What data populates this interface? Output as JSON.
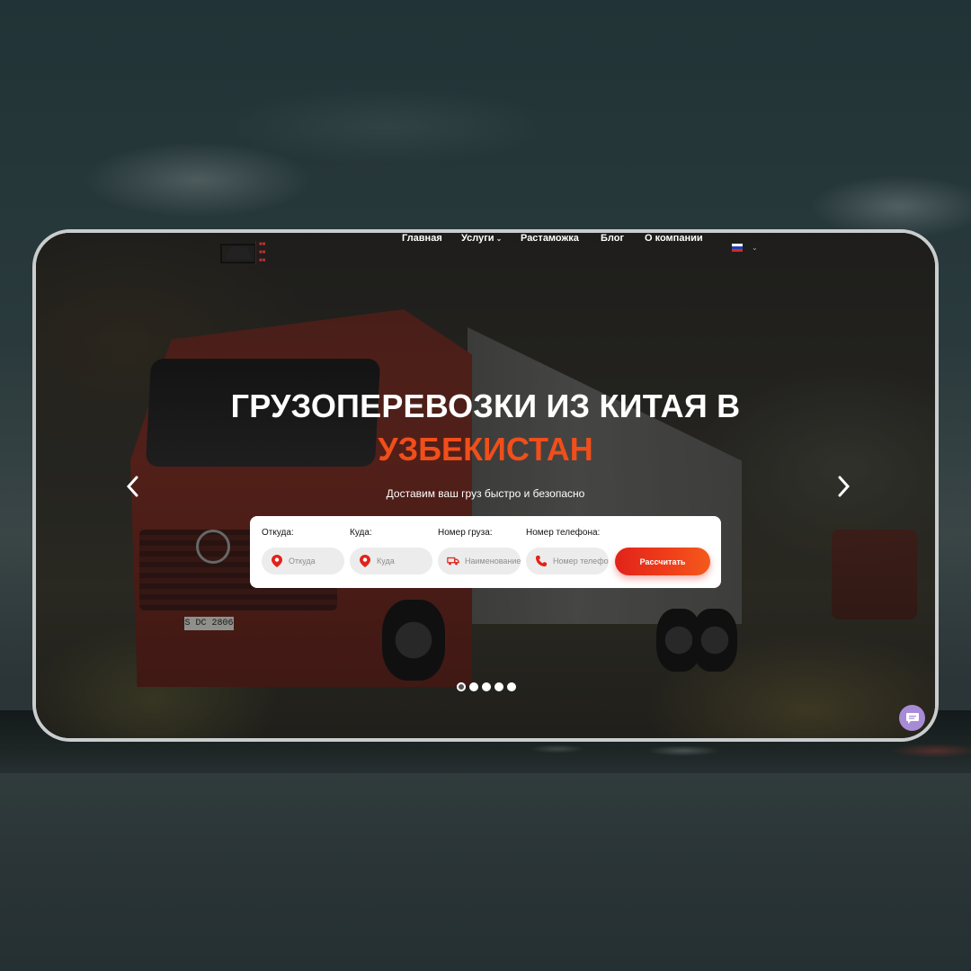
{
  "nav": {
    "items": [
      {
        "label": "Главная"
      },
      {
        "label": "Услуги"
      },
      {
        "label": "Растаможка"
      },
      {
        "label": "Блог"
      },
      {
        "label": "О компании"
      }
    ],
    "language": "ru"
  },
  "hero": {
    "title": "ГРУЗОПЕРЕВОЗКИ ИЗ КИТАЯ В",
    "title_accent": "УЗБЕКИСТАН",
    "subtitle": "Доставим ваш груз быстро и безопасно",
    "accent_color": "#f04e1a",
    "truck_plate": "S DC 2806"
  },
  "form": {
    "from": {
      "label": "Откуда:",
      "placeholder": "Откуда",
      "icon": "map-pin-icon"
    },
    "to": {
      "label": "Куда:",
      "placeholder": "Куда",
      "icon": "map-pin-icon"
    },
    "cargo": {
      "label": "Номер груза:",
      "placeholder": "Наименование",
      "icon": "truck-icon"
    },
    "phone": {
      "label": "Номер телефона:",
      "placeholder": "Номер телефона",
      "icon": "phone-icon"
    },
    "submit_label": "Рассчитать"
  },
  "slider": {
    "total": 5,
    "active": 1
  },
  "colors": {
    "brand": "#e2231a",
    "chat": "#a88bd6"
  }
}
